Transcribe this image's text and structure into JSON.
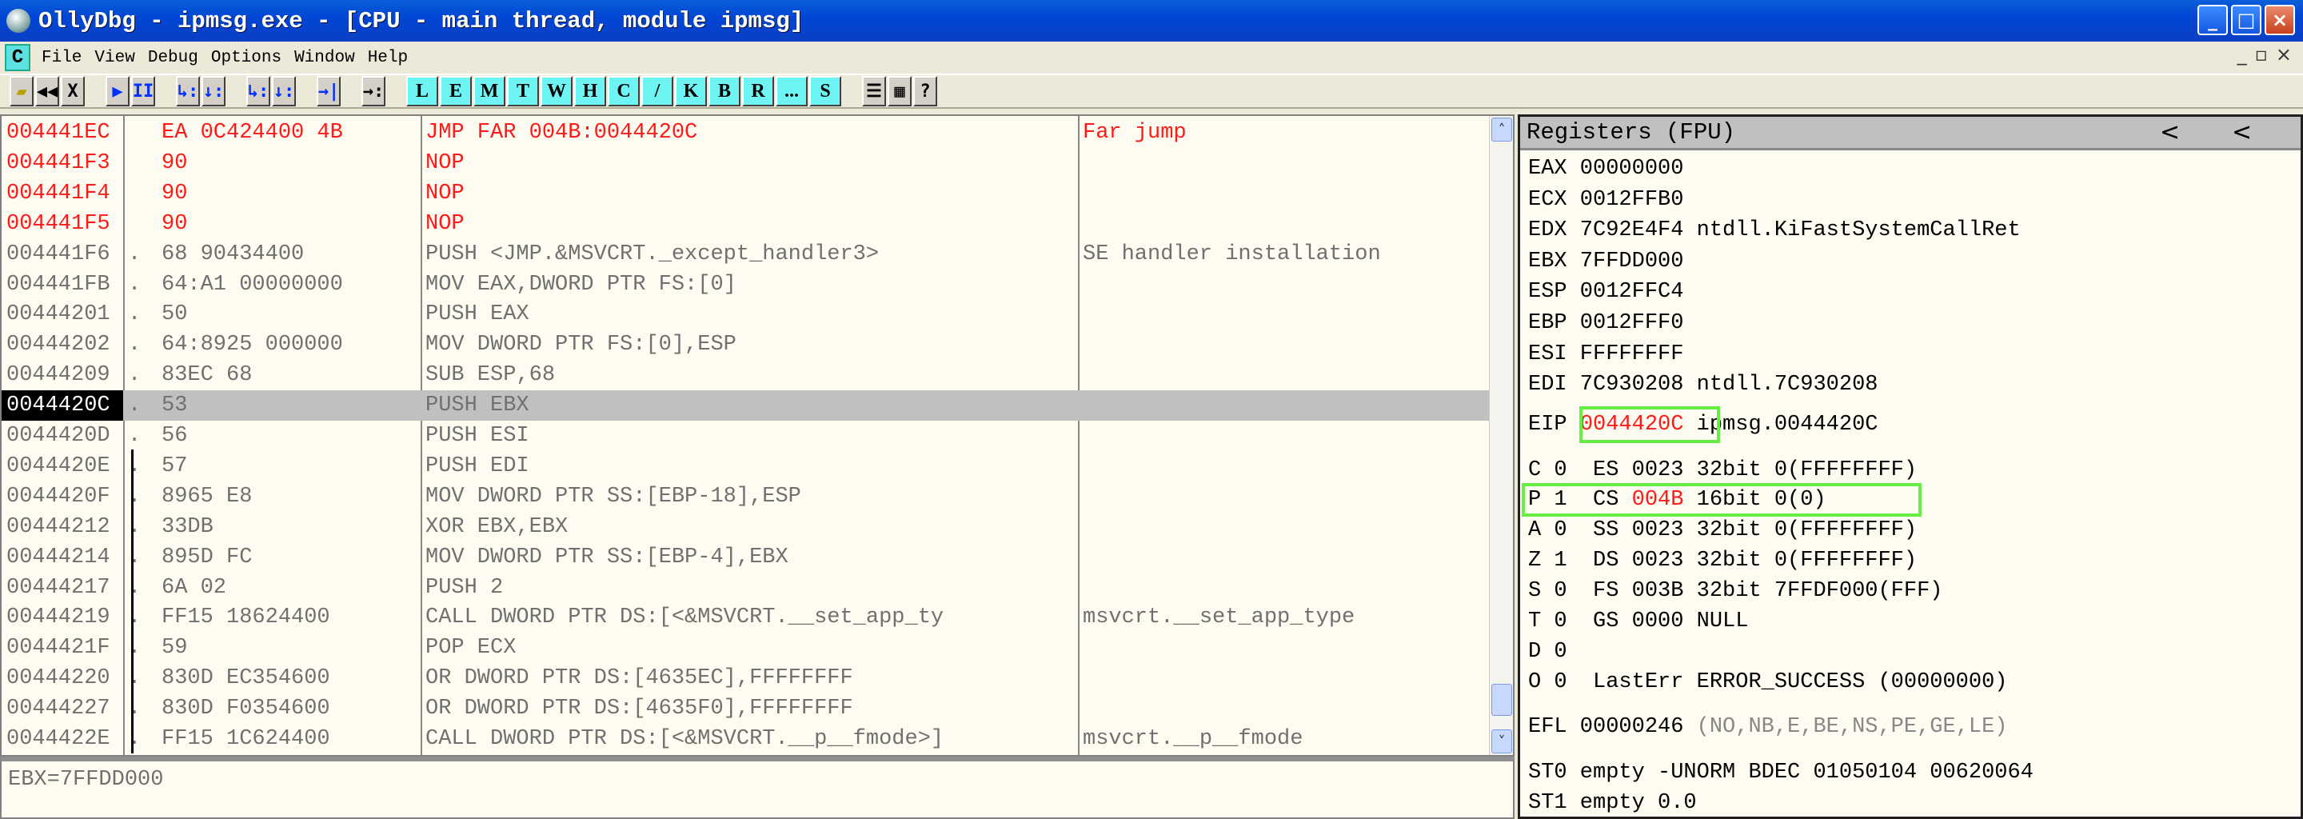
{
  "window": {
    "title": "OllyDbg - ipmsg.exe - [CPU - main thread, module ipmsg]",
    "minimize": "_",
    "maximize": "□",
    "close": "×"
  },
  "menu": {
    "icon": "C",
    "items": [
      "File",
      "View",
      "Debug",
      "Options",
      "Window",
      "Help"
    ],
    "mdi": [
      "_",
      "▫",
      "×"
    ]
  },
  "toolbar": {
    "buttons": [
      "▰",
      "◀◀",
      "X",
      "▶",
      "II",
      "↳:",
      "↓:",
      "↳:",
      "↓:",
      "→|",
      "→:"
    ],
    "letters": [
      "L",
      "E",
      "M",
      "T",
      "W",
      "H",
      "C",
      "/",
      "K",
      "B",
      "R",
      "...",
      "S"
    ],
    "extras": [
      "☰",
      "▦",
      "?"
    ]
  },
  "disasm": {
    "rows": [
      {
        "addr": "004441EC",
        "dot": "",
        "hex": "EA 0C424400 4B",
        "dis": "JMP FAR 004B:0044420C",
        "com": "Far jump",
        "red": true
      },
      {
        "addr": "004441F3",
        "dot": "",
        "hex": "90",
        "dis": "NOP",
        "com": "",
        "red": true
      },
      {
        "addr": "004441F4",
        "dot": "",
        "hex": "90",
        "dis": "NOP",
        "com": "",
        "red": true
      },
      {
        "addr": "004441F5",
        "dot": "",
        "hex": "90",
        "dis": "NOP",
        "com": "",
        "red": true
      },
      {
        "addr": "004441F6",
        "dot": ".",
        "hex": "68 90434400",
        "dis": "PUSH <JMP.&MSVCRT._except_handler3>",
        "com": "SE handler installation"
      },
      {
        "addr": "004441FB",
        "dot": ".",
        "hex": "64:A1 00000000",
        "dis": "MOV EAX,DWORD PTR FS:[0]",
        "com": ""
      },
      {
        "addr": "00444201",
        "dot": ".",
        "hex": "50",
        "dis": "PUSH EAX",
        "com": ""
      },
      {
        "addr": "00444202",
        "dot": ".",
        "hex": "64:8925 000000",
        "dis": "MOV DWORD PTR FS:[0],ESP",
        "com": ""
      },
      {
        "addr": "00444209",
        "dot": ".",
        "hex": "83EC 68",
        "dis": "SUB ESP,68",
        "com": ""
      },
      {
        "addr": "0044420C",
        "dot": ".",
        "hex": "53",
        "dis": "PUSH EBX",
        "com": "",
        "sel": true
      },
      {
        "addr": "0044420D",
        "dot": ".",
        "hex": "56",
        "dis": "PUSH ESI",
        "com": ""
      },
      {
        "addr": "0044420E",
        "dot": ".",
        "hex": "57",
        "dis": "PUSH EDI",
        "com": ""
      },
      {
        "addr": "0044420F",
        "dot": ".",
        "hex": "8965 E8",
        "dis": "MOV DWORD PTR SS:[EBP-18],ESP",
        "com": ""
      },
      {
        "addr": "00444212",
        "dot": ".",
        "hex": "33DB",
        "dis": "XOR EBX,EBX",
        "com": ""
      },
      {
        "addr": "00444214",
        "dot": ".",
        "hex": "895D FC",
        "dis": "MOV DWORD PTR SS:[EBP-4],EBX",
        "com": ""
      },
      {
        "addr": "00444217",
        "dot": ".",
        "hex": "6A 02",
        "dis": "PUSH 2",
        "com": ""
      },
      {
        "addr": "00444219",
        "dot": ".",
        "hex": "FF15 18624400",
        "dis": "CALL DWORD PTR DS:[<&MSVCRT.__set_app_ty",
        "com": "msvcrt.__set_app_type"
      },
      {
        "addr": "0044421F",
        "dot": ".",
        "hex": "59",
        "dis": "POP ECX",
        "com": ""
      },
      {
        "addr": "00444220",
        "dot": ".",
        "hex": "830D EC354600",
        "dis": "OR DWORD PTR DS:[4635EC],FFFFFFFF",
        "com": ""
      },
      {
        "addr": "00444227",
        "dot": ".",
        "hex": "830D F0354600",
        "dis": "OR DWORD PTR DS:[4635F0],FFFFFFFF",
        "com": ""
      },
      {
        "addr": "0044422E",
        "dot": ".",
        "hex": "FF15 1C624400",
        "dis": "CALL DWORD PTR DS:[<&MSVCRT.__p__fmode>]",
        "com": "msvcrt.__p__fmode"
      }
    ]
  },
  "info": {
    "text": "EBX=7FFDD000"
  },
  "registers": {
    "title": "Registers (FPU)",
    "chev1": "<",
    "chev2": "<",
    "gp": [
      "EAX 00000000",
      "ECX 0012FFB0",
      "EDX 7C92E4F4 ntdll.KiFastSystemCallRet",
      "EBX 7FFDD000",
      "ESP 0012FFC4",
      "EBP 0012FFF0",
      "ESI FFFFFFFF",
      "EDI 7C930208 ntdll.7C930208"
    ],
    "eip": {
      "label": "EIP ",
      "value": "0044420C",
      "comment": " ipmsg.0044420C"
    },
    "es": "C 0  ES 0023 32bit 0(FFFFFFFF)",
    "cs": {
      "prefix": "P 1  CS ",
      "value": "004B",
      "suffix": " 16bit 0(0)"
    },
    "segs": [
      "A 0  SS 0023 32bit 0(FFFFFFFF)",
      "Z 1  DS 0023 32bit 0(FFFFFFFF)",
      "S 0  FS 003B 32bit 7FFDF000(FFF)",
      "T 0  GS 0000 NULL",
      "D 0",
      "O 0  LastErr ERROR_SUCCESS (00000000)"
    ],
    "efl": {
      "label": "EFL 00000246 ",
      "flags": "(NO,NB,E,BE,NS,PE,GE,LE)"
    },
    "fpu": [
      "ST0 empty -UNORM BDEC 01050104 00620064",
      "ST1 empty 0.0"
    ]
  },
  "colors": {
    "accent_red": "#ff1a1a",
    "highlight_box": "#66ee44",
    "titlebar": "#0a5fd8"
  }
}
